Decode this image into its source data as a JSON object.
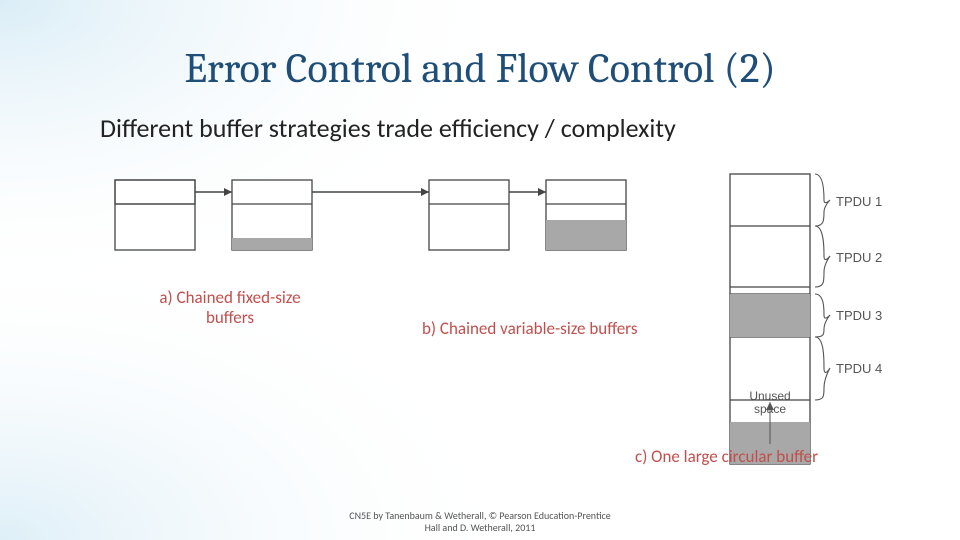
{
  "slide": {
    "title": "Error Control and Flow Control (2)",
    "subtitle": "Different buffer strategies trade efficiency / complexity",
    "label_a_line1": "a) Chained fixed-size",
    "label_a_line2": "buffers",
    "label_b": "b) Chained variable-size buffers",
    "label_c": "c) One large circular buffer",
    "tpdu": [
      "TPDU 1",
      "TPDU 2",
      "TPDU 3",
      "TPDU 4"
    ],
    "unused_line1": "Unused",
    "unused_line2": "space",
    "footer_line1": "CN5E by Tanenbaum & Wetherall, © Pearson Education-Prentice",
    "footer_line2": "Hall and D. Wetherall, 2011"
  }
}
